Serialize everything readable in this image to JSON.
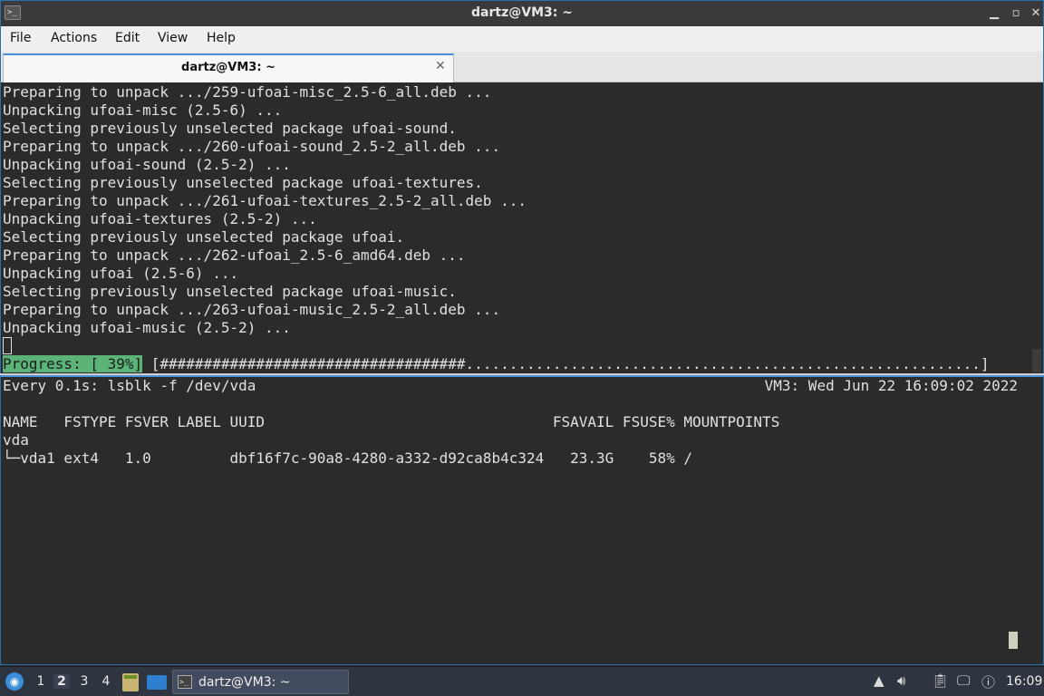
{
  "window": {
    "title": "dartz@VM3: ~"
  },
  "menu": {
    "items": [
      "File",
      "Actions",
      "Edit",
      "View",
      "Help"
    ]
  },
  "tabs": [
    {
      "label": "dartz@VM3: ~"
    }
  ],
  "top_pane": {
    "lines": [
      "Preparing to unpack .../259-ufoai-misc_2.5-6_all.deb ...",
      "Unpacking ufoai-misc (2.5-6) ...",
      "Selecting previously unselected package ufoai-sound.",
      "Preparing to unpack .../260-ufoai-sound_2.5-2_all.deb ...",
      "Unpacking ufoai-sound (2.5-2) ...",
      "Selecting previously unselected package ufoai-textures.",
      "Preparing to unpack .../261-ufoai-textures_2.5-2_all.deb ...",
      "Unpacking ufoai-textures (2.5-2) ...",
      "Selecting previously unselected package ufoai.",
      "Preparing to unpack .../262-ufoai_2.5-6_amd64.deb ...",
      "Unpacking ufoai (2.5-6) ...",
      "Selecting previously unselected package ufoai-music.",
      "Preparing to unpack .../263-ufoai-music_2.5-2_all.deb ...",
      "Unpacking ufoai-music (2.5-2) ..."
    ],
    "progress_label": "Progress: [ 39%]",
    "progress_bar": " [###################################...........................................................]",
    "progress_percent": 39
  },
  "bottom_pane": {
    "watch_header_left": "Every 0.1s: lsblk -f /dev/vda",
    "watch_header_right": "VM3: Wed Jun 22 16:09:02 2022",
    "table_header": "NAME   FSTYPE FSVER LABEL UUID                                 FSAVAIL FSUSE% MOUNTPOINTS",
    "rows": [
      "vda",
      "└─vda1 ext4   1.0         dbf16f7c-90a8-4280-a332-d92ca8b4c324   23.3G    58% /"
    ]
  },
  "taskbar": {
    "workspaces": [
      "1",
      "2",
      "3",
      "4"
    ],
    "active_workspace": "2",
    "task_label": "dartz@VM3: ~",
    "clock": "16:09"
  }
}
